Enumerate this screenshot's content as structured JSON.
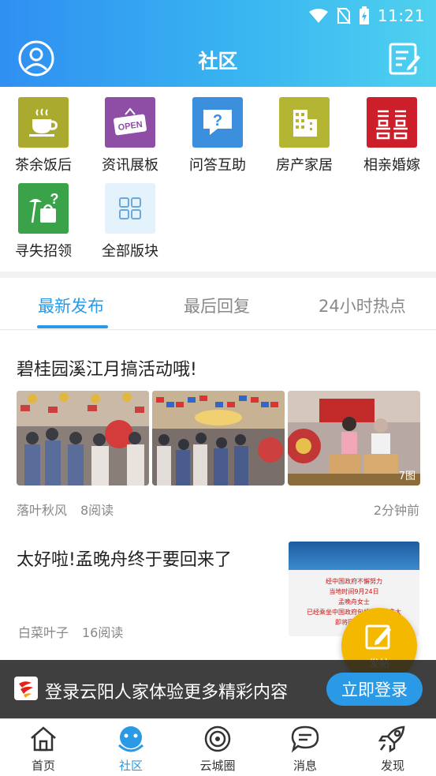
{
  "status_bar": {
    "time": "11:21"
  },
  "header": {
    "title": "社区"
  },
  "categories": [
    {
      "label": "茶余饭后",
      "icon": "coffee-cup-icon",
      "color": "#a9aa2e"
    },
    {
      "label": "资讯展板",
      "icon": "open-sign-icon",
      "color": "#8e4ea6"
    },
    {
      "label": "问答互助",
      "icon": "question-bubble-icon",
      "color": "#3b8fdd"
    },
    {
      "label": "房产家居",
      "icon": "building-icon",
      "color": "#b4b532"
    },
    {
      "label": "相亲婚嫁",
      "icon": "double-happiness-icon",
      "color": "#cc1f2a"
    },
    {
      "label": "寻失招领",
      "icon": "lost-found-icon",
      "color": "#3aa34a"
    },
    {
      "label": "全部版块",
      "icon": "grid-icon",
      "color": "#e4f2fb"
    }
  ],
  "tabs": [
    {
      "label": "最新发布",
      "active": true
    },
    {
      "label": "最后回复",
      "active": false
    },
    {
      "label": "24小时热点",
      "active": false
    }
  ],
  "posts": [
    {
      "title": "碧桂园溪江月搞活动哦!",
      "author": "落叶秋风",
      "reads": "8阅读",
      "time": "2分钟前",
      "image_count": "7图"
    },
    {
      "title": "太好啦!孟晚舟终于要回来了",
      "author": "白菜叶子",
      "reads": "16阅读",
      "thumb_lines": [
        "经中国政府不懈努力",
        "当地时间9月24日",
        "孟晚舟女士",
        "已经乘坐中国政府包机离开加拿大",
        "即将回到祖国"
      ]
    }
  ],
  "fab": {
    "label": "发帖"
  },
  "login_banner": {
    "message": "登录云阳人家体验更多精彩内容",
    "button": "立即登录"
  },
  "bottom_nav": [
    {
      "label": "首页",
      "icon": "home-icon",
      "active": false
    },
    {
      "label": "社区",
      "icon": "community-icon",
      "active": true
    },
    {
      "label": "云城圈",
      "icon": "circle-icon",
      "active": false
    },
    {
      "label": "消息",
      "icon": "message-icon",
      "active": false
    },
    {
      "label": "发现",
      "icon": "rocket-icon",
      "active": false
    }
  ],
  "colors": {
    "accent": "#2a9ae6",
    "fab": "#f5b800"
  }
}
